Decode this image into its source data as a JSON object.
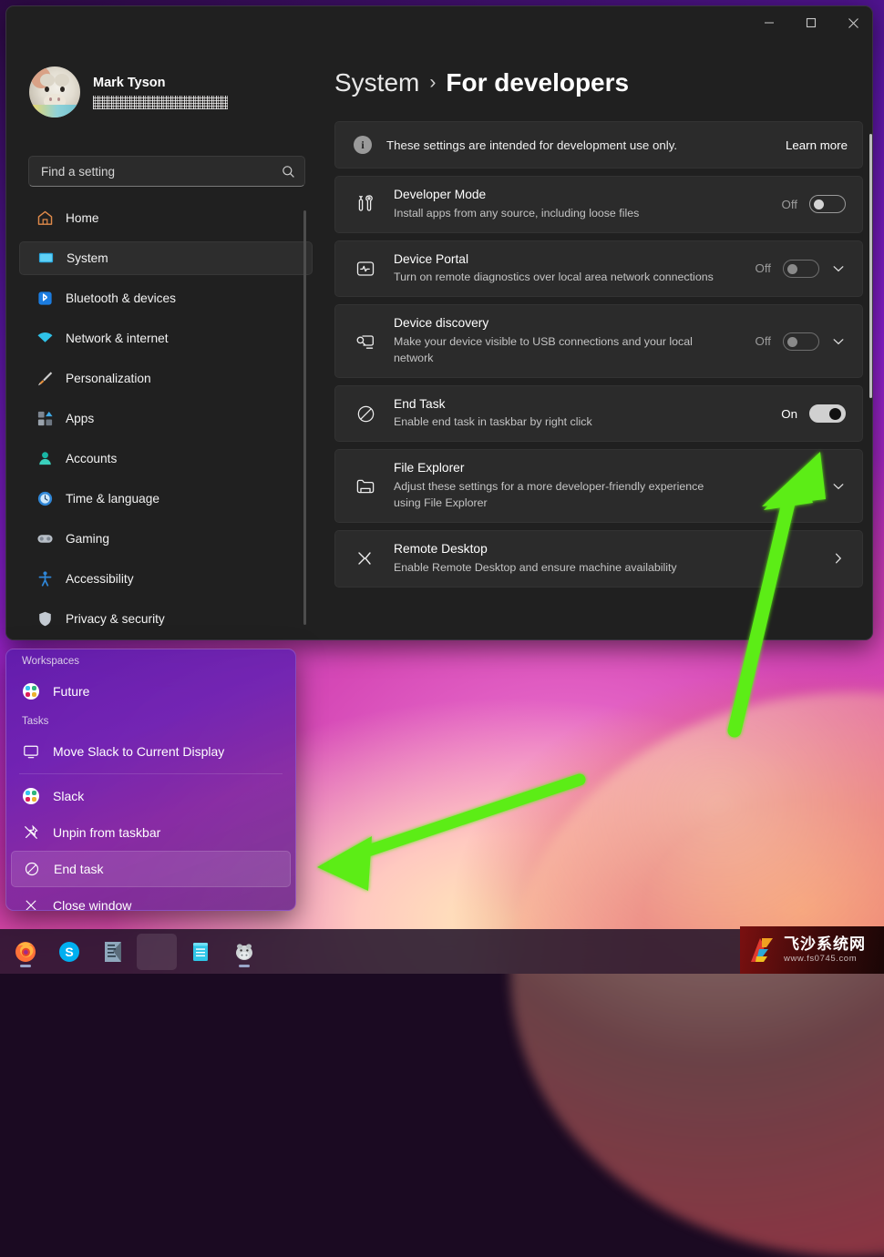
{
  "window": {
    "controls": {
      "minimize": "minimize-button",
      "maximize": "maximize-button",
      "close": "close-button"
    }
  },
  "sidebar": {
    "profile": {
      "name": "Mark Tyson",
      "email_redacted": true
    },
    "search": {
      "placeholder": "Find a setting",
      "value": ""
    },
    "items": [
      {
        "label": "Home",
        "icon": "home-icon",
        "selected": false
      },
      {
        "label": "System",
        "icon": "system-monitor-icon",
        "selected": true
      },
      {
        "label": "Bluetooth & devices",
        "icon": "bluetooth-icon",
        "selected": false
      },
      {
        "label": "Network & internet",
        "icon": "wifi-icon",
        "selected": false
      },
      {
        "label": "Personalization",
        "icon": "paintbrush-icon",
        "selected": false
      },
      {
        "label": "Apps",
        "icon": "apps-icon",
        "selected": false
      },
      {
        "label": "Accounts",
        "icon": "account-person-icon",
        "selected": false
      },
      {
        "label": "Time & language",
        "icon": "clock-globe-icon",
        "selected": false
      },
      {
        "label": "Gaming",
        "icon": "gamepad-icon",
        "selected": false
      },
      {
        "label": "Accessibility",
        "icon": "accessibility-person-icon",
        "selected": false
      },
      {
        "label": "Privacy & security",
        "icon": "shield-icon",
        "selected": false
      }
    ]
  },
  "content": {
    "breadcrumb": {
      "parent": "System",
      "separator": "›",
      "current": "For developers"
    },
    "banner": {
      "icon": "info-icon",
      "text": "These settings are intended for development use only.",
      "link": "Learn more"
    },
    "settings": [
      {
        "title": "Developer Mode",
        "description": "Install apps from any source, including loose files",
        "icon": "tools-icon",
        "toggle_state": "Off",
        "toggle_on": false,
        "toggle_dim": false,
        "expander": "none"
      },
      {
        "title": "Device Portal",
        "description": "Turn on remote diagnostics over local area network connections",
        "icon": "device-portal-icon",
        "toggle_state": "Off",
        "toggle_on": false,
        "toggle_dim": true,
        "expander": "chevron-down-icon"
      },
      {
        "title": "Device discovery",
        "description": "Make your device visible to USB connections and your local network",
        "icon": "device-discovery-icon",
        "toggle_state": "Off",
        "toggle_on": false,
        "toggle_dim": true,
        "expander": "chevron-down-icon"
      },
      {
        "title": "End Task",
        "description": "Enable end task in taskbar by right click",
        "icon": "end-task-icon",
        "toggle_state": "On",
        "toggle_on": true,
        "toggle_dim": false,
        "expander": "none"
      },
      {
        "title": "File Explorer",
        "description": "Adjust these settings for a more developer-friendly experience using File Explorer",
        "icon": "folder-icon",
        "toggle_state": "",
        "toggle_on": false,
        "toggle_dim": false,
        "expander": "chevron-down-icon"
      },
      {
        "title": "Remote Desktop",
        "description": "Enable Remote Desktop and ensure machine availability",
        "icon": "remote-desktop-icon",
        "toggle_state": "",
        "toggle_on": false,
        "toggle_dim": false,
        "expander": "chevron-right-icon"
      }
    ]
  },
  "context_menu": {
    "sections": [
      {
        "header": "Workspaces",
        "items": [
          {
            "label": "Future",
            "icon": "slack-logo-icon",
            "highlighted": false
          }
        ]
      },
      {
        "header": "Tasks",
        "items": [
          {
            "label": "Move Slack to Current Display",
            "icon": "monitor-icon",
            "highlighted": false
          }
        ]
      },
      {
        "header": "",
        "items": [
          {
            "label": "Slack",
            "icon": "slack-logo-icon",
            "highlighted": false
          },
          {
            "label": "Unpin from taskbar",
            "icon": "unpin-icon",
            "highlighted": false
          },
          {
            "label": "End task",
            "icon": "end-task-icon",
            "highlighted": true
          },
          {
            "label": "Close window",
            "icon": "close-x-icon",
            "highlighted": false
          }
        ]
      }
    ]
  },
  "taskbar": {
    "icons": [
      {
        "name": "firefox-icon",
        "running": true
      },
      {
        "name": "skype-icon",
        "running": false
      },
      {
        "name": "slack-app-icon",
        "running": false
      },
      {
        "name": "active-window-slot",
        "running": false
      },
      {
        "name": "notepad-icon",
        "running": false
      },
      {
        "name": "hippo-app-icon",
        "running": true
      }
    ]
  },
  "watermark": {
    "title": "飞沙系统网",
    "url": "www.fs0745.com"
  },
  "annotations": {
    "arrow_color": "#5ced16",
    "arrows": [
      {
        "name": "arrow-to-end-task-toggle",
        "points_to": "End Task toggle"
      },
      {
        "name": "arrow-to-context-menu-end-task",
        "points_to": "End task context menu item"
      }
    ]
  },
  "colors": {
    "window_bg": "#202020",
    "card_bg": "#2b2b2b",
    "accent_green": "#5ced16",
    "text_primary": "#ffffff",
    "text_secondary": "#c4c4c4"
  }
}
